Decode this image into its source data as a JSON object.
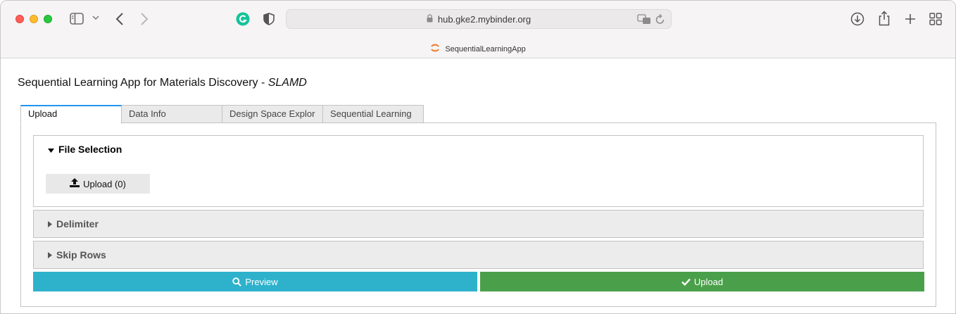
{
  "browser": {
    "url": "hub.gke2.mybinder.org",
    "tab_title": "SequentialLearningApp"
  },
  "app": {
    "title_main": "Sequential Learning App for Materials Discovery - ",
    "title_italic": "SLAMD"
  },
  "tabs": [
    {
      "label": "Upload",
      "active": true
    },
    {
      "label": "Data Info",
      "active": false
    },
    {
      "label": "Design Space Explor",
      "active": false
    },
    {
      "label": "Sequential Learning",
      "active": false
    }
  ],
  "file_selection": {
    "header": "File Selection",
    "upload_button": "Upload (0)"
  },
  "delimiter": {
    "header": "Delimiter"
  },
  "skip_rows": {
    "header": "Skip Rows"
  },
  "actions": {
    "preview_label": "Preview",
    "upload_label": "Upload"
  },
  "colors": {
    "preview": "#2eb2cc",
    "upload": "#4aa04a",
    "active_tab": "#2196f3"
  }
}
